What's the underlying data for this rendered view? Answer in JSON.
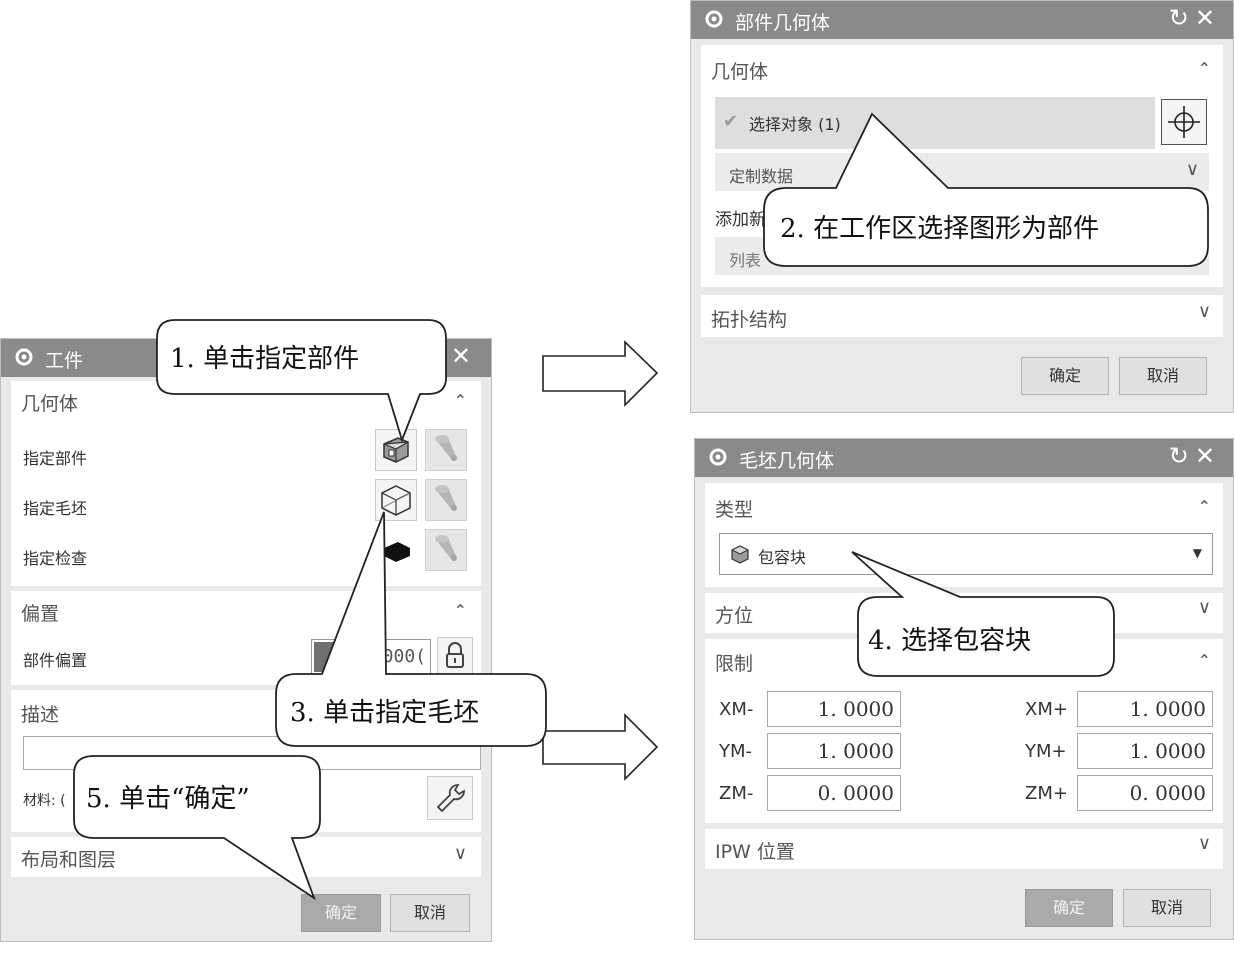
{
  "workpiece": {
    "title": "工件",
    "geometry_header": "几何体",
    "specify_part": "指定部件",
    "specify_blank": "指定毛坯",
    "specify_check": "指定检查",
    "offset_header": "偏置",
    "part_offset": "部件偏置",
    "offset_value": "000(",
    "description_header": "描述",
    "material_label": "材料: (",
    "layout_header": "布局和图层",
    "ok": "确定",
    "cancel": "取消"
  },
  "part_geometry": {
    "title": "部件几何体",
    "geometry_header": "几何体",
    "select_object": "选择对象 (1)",
    "custom_data": "定制数据",
    "add_label": "添加新",
    "list_label": "列表",
    "topology_header": "拓扑结构",
    "ok": "确定",
    "cancel": "取消"
  },
  "blank_geometry": {
    "title": "毛坯几何体",
    "type_header": "类型",
    "type_value": "包容块",
    "orientation_header": "方位",
    "limits_header": "限制",
    "limits": [
      {
        "label": "XM-",
        "value": "1. 0000"
      },
      {
        "label": "XM+",
        "value": "1. 0000"
      },
      {
        "label": "YM-",
        "value": "1. 0000"
      },
      {
        "label": "YM+",
        "value": "1. 0000"
      },
      {
        "label": "ZM-",
        "value": "0. 0000"
      },
      {
        "label": "ZM+",
        "value": "0. 0000"
      }
    ],
    "ipw_header": "IPW 位置",
    "ok": "确定",
    "cancel": "取消"
  },
  "callouts": {
    "c1": "1. 单击指定部件",
    "c2": "2. 在工作区选择图形为部件",
    "c3": "3. 单击指定毛坯",
    "c4": "4. 选择包容块",
    "c5": "5. 单击“确定”"
  },
  "colors": {
    "titlebar": "#8a8a8a",
    "dialog_bg": "#e9e9e9",
    "section_bg": "#ffffff",
    "primary_button": "#a9a9a9"
  }
}
